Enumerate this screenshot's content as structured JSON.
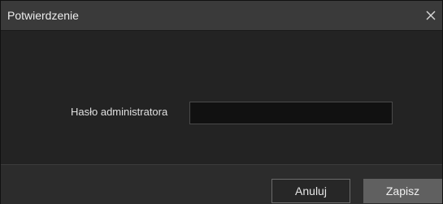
{
  "dialog": {
    "title": "Potwierdzenie",
    "close_icon": "close-icon"
  },
  "form": {
    "password_label": "Hasło administratora",
    "password_value": ""
  },
  "footer": {
    "cancel_label": "Anuluj",
    "save_label": "Zapisz"
  },
  "colors": {
    "titlebar": "#3a3a3a",
    "body": "#232323",
    "footer": "#2c2c2c",
    "input_bg": "#111111",
    "save_button": "#606060"
  }
}
